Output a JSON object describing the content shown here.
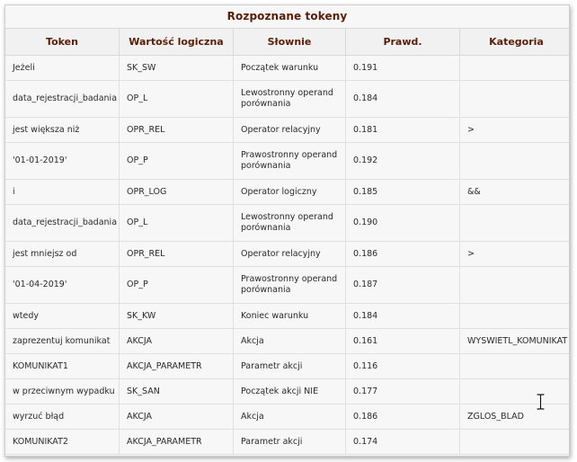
{
  "table": {
    "caption": "Rozpoznane tokeny",
    "headers": [
      "Token",
      "Wartość logiczna",
      "Słownie",
      "Prawd.",
      "Kategoria"
    ],
    "rows": [
      {
        "token": "Jeżeli",
        "logic": "SK_SW",
        "words": "Początek warunku",
        "prob": "0.191",
        "category": ""
      },
      {
        "token": "data_rejestracji_badania",
        "logic": "OP_L",
        "words": "Lewostronny operand porównania",
        "prob": "0.184",
        "category": ""
      },
      {
        "token": "jest większa niż",
        "logic": "OPR_REL",
        "words": "Operator relacyjny",
        "prob": "0.181",
        "category": ">"
      },
      {
        "token": "'01-01-2019'",
        "logic": "OP_P",
        "words": "Prawostronny operand porównania",
        "prob": "0.192",
        "category": ""
      },
      {
        "token": "i",
        "logic": "OPR_LOG",
        "words": "Operator logiczny",
        "prob": "0.185",
        "category": "&&"
      },
      {
        "token": "data_rejestracji_badania",
        "logic": "OP_L",
        "words": "Lewostronny operand porównania",
        "prob": "0.190",
        "category": ""
      },
      {
        "token": "jest mniejsz od",
        "logic": "OPR_REL",
        "words": "Operator relacyjny",
        "prob": "0.186",
        "category": ">"
      },
      {
        "token": "'01-04-2019'",
        "logic": "OP_P",
        "words": "Prawostronny operand porównania",
        "prob": "0.187",
        "category": ""
      },
      {
        "token": "wtedy",
        "logic": "SK_KW",
        "words": "Koniec warunku",
        "prob": "0.184",
        "category": ""
      },
      {
        "token": "zaprezentuj komunikat",
        "logic": "AKCJA",
        "words": "Akcja",
        "prob": "0.161",
        "category": "WYSWIETL_KOMUNIKAT"
      },
      {
        "token": "KOMUNIKAT1",
        "logic": "AKCJA_PARAMETR",
        "words": "Parametr akcji",
        "prob": "0.116",
        "category": ""
      },
      {
        "token": "w przeciwnym wypadku",
        "logic": "SK_SAN",
        "words": "Początek akcji NIE",
        "prob": "0.177",
        "category": ""
      },
      {
        "token": "wyrzuć błąd",
        "logic": "AKCJA",
        "words": "Akcja",
        "prob": "0.186",
        "category": "ZGLOS_BLAD"
      },
      {
        "token": "KOMUNIKAT2",
        "logic": "AKCJA_PARAMETR",
        "words": "Parametr akcji",
        "prob": "0.174",
        "category": ""
      }
    ]
  }
}
